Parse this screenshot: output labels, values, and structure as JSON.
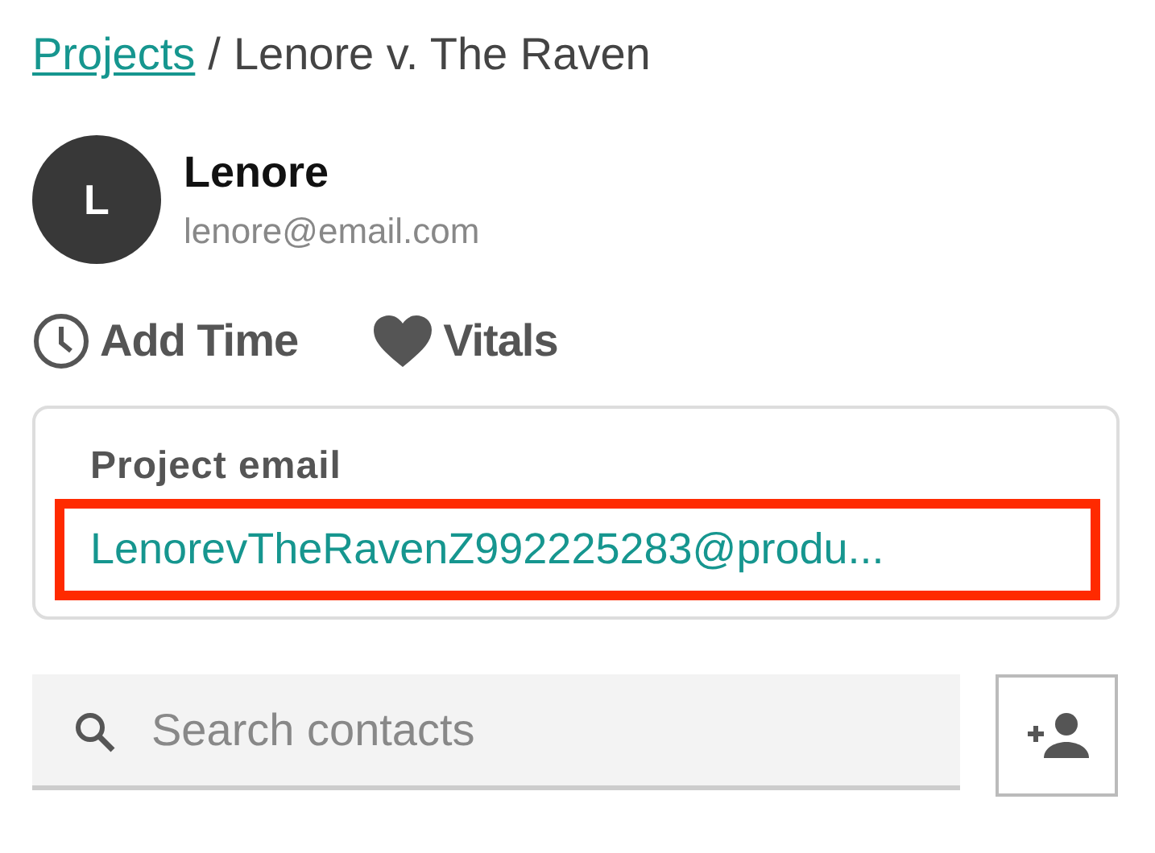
{
  "breadcrumb": {
    "link": "Projects",
    "separator": "/",
    "current": "Lenore v. The Raven"
  },
  "contact": {
    "initial": "L",
    "name": "Lenore",
    "email": "lenore@email.com"
  },
  "actions": [
    {
      "kind": "clock",
      "label": "Add Time"
    },
    {
      "kind": "heart",
      "label": "Vitals"
    }
  ],
  "project_email": {
    "label": "Project email",
    "value": "LenorevTheRavenZ992225283@produ...",
    "highlighted": true
  },
  "search": {
    "placeholder": "Search contacts"
  }
}
